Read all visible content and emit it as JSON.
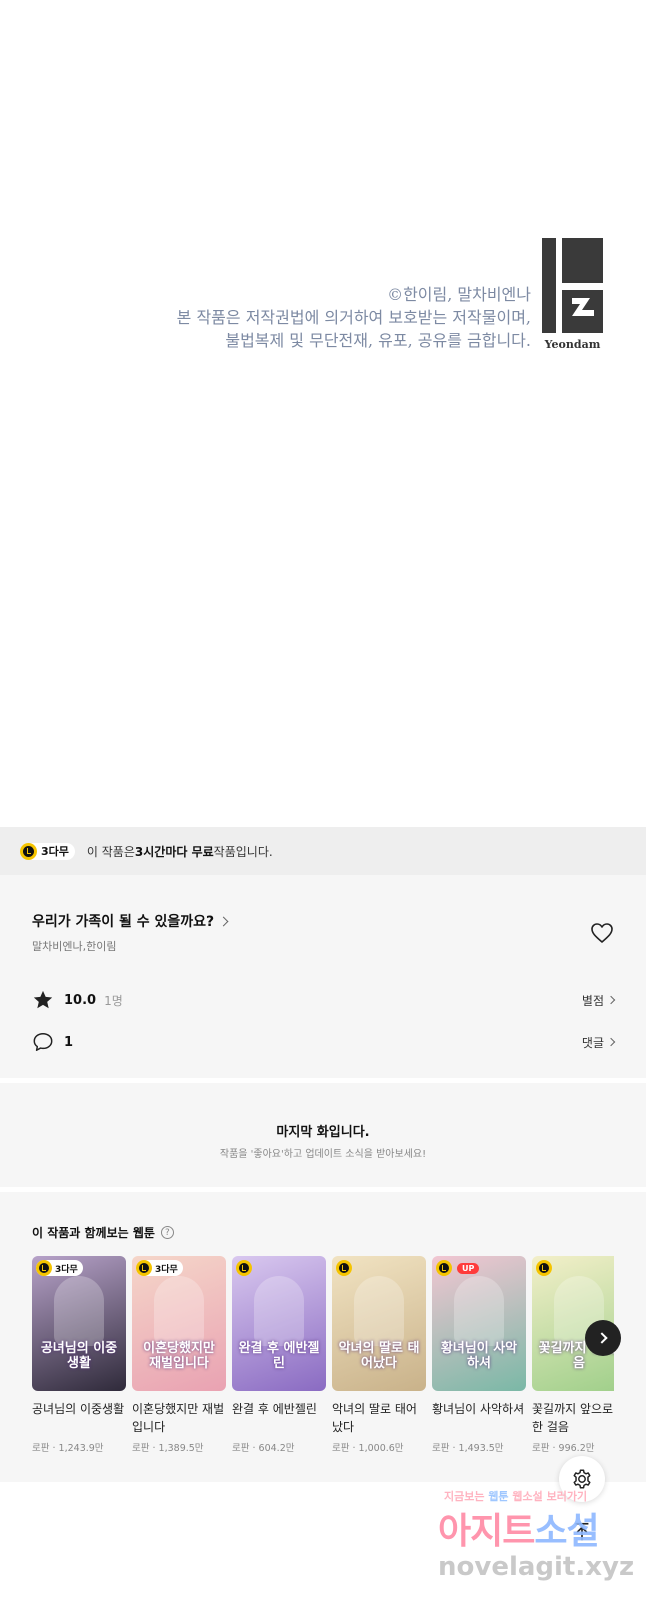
{
  "copyright": {
    "lines": [
      "©한이림, 말차비엔나",
      "본 작품은 저작권법에 의거하여 보호받는 저작물이며,",
      "불법복제 및 무단전재, 유포, 공유를 금합니다."
    ],
    "publisher_logo_text": "Yeondam"
  },
  "free_notice": {
    "badge": "3다무",
    "prefix": "이 작품은 ",
    "highlight": "3시간마다 무료",
    "suffix": " 작품입니다."
  },
  "work": {
    "title": "우리가 가족이 될 수 있을까요?",
    "authors": "말차비엔나,한이림",
    "rating": "10.0",
    "rating_count": "1명",
    "rating_link": "별점",
    "comment_count": "1",
    "comment_link": "댓글"
  },
  "last_episode": {
    "title": "마지막 화입니다.",
    "subtitle": "작품을 '좋아요'하고 업데이트 소식을 받아보세요!"
  },
  "recommendations": {
    "heading": "이 작품과 함께보는 웹툰",
    "help": "?",
    "items": [
      {
        "title": "공녀님의 이중생활",
        "meta": "로판 · 1,243.9만",
        "badge": "3다무",
        "art_title": "공녀님의 이중생활",
        "color_a": "#2f2a3a",
        "color_b": "#b7a2c9"
      },
      {
        "title": "이혼당했지만 재벌입니다",
        "meta": "로판 · 1,389.5만",
        "badge": "3다무",
        "art_title": "이혼당했지만 재벌입니다",
        "color_a": "#e9a2b2",
        "color_b": "#f5d6c9"
      },
      {
        "title": "완결 후 에반젤린",
        "meta": "로판 · 604.2만",
        "badge": "",
        "art_title": "완결 후 에반젤린",
        "color_a": "#8a6bc2",
        "color_b": "#d9c8ef"
      },
      {
        "title": "악녀의 딸로 태어났다",
        "meta": "로판 · 1,000.6만",
        "badge": "",
        "art_title": "악녀의 딸로 태어났다",
        "color_a": "#c9b28a",
        "color_b": "#f1e3c2"
      },
      {
        "title": "황녀님이 사악하셔",
        "meta": "로판 · 1,493.5만",
        "badge": "UP",
        "art_title": "황녀님이 사악하셔",
        "color_a": "#7ab8a6",
        "color_b": "#f2c6d2"
      },
      {
        "title": "꽃길까지 앞으로 한 걸음",
        "meta": "로판 · 996.2만",
        "badge": "",
        "art_title": "꽃길까지 한 걸음",
        "color_a": "#9fcf8a",
        "color_b": "#f3efc9"
      }
    ]
  },
  "watermark": {
    "top_line_a": "지금보는 ",
    "top_line_hl": "웹툰",
    "top_line_b": " 웹소설 보러가기",
    "main_a": "아지트",
    "main_b": "소설",
    "url": "novelagit.xyz"
  },
  "colors": {
    "accent_yellow": "#f5c400",
    "copyright_text": "#7d8aa3",
    "up_badge": "#ff3b3b"
  }
}
